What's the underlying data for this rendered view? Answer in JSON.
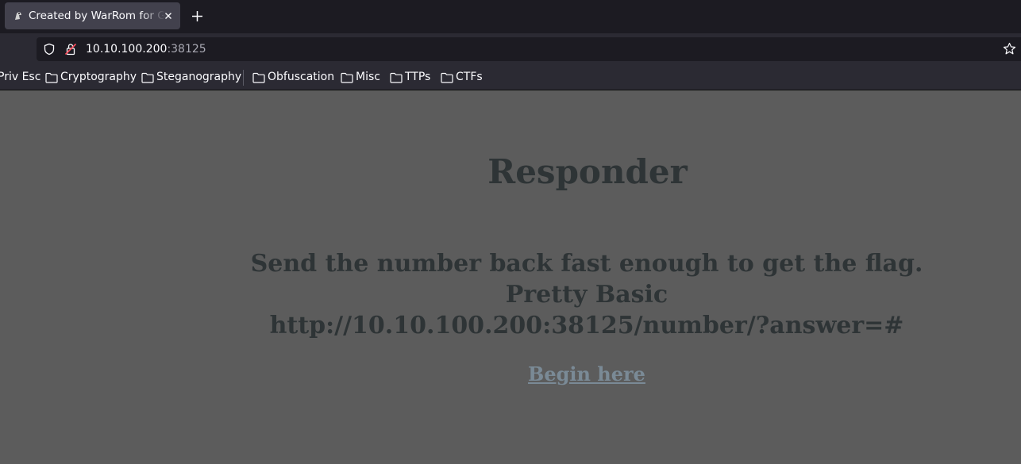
{
  "browser": {
    "tab_title": "Created by WarRom for GitHub",
    "url_host": "10.10.100.200",
    "url_port": ":38125",
    "bookmarks": [
      {
        "label": "Priv Esc",
        "icon": ""
      },
      {
        "label": "Cryptography",
        "icon": "folder-icon"
      },
      {
        "label": "Steganography",
        "icon": "folder-icon"
      },
      {
        "label": "Obfuscation",
        "icon": "folder-icon"
      },
      {
        "label": "Misc",
        "icon": "folder-icon"
      },
      {
        "label": "TTPs",
        "icon": "folder-icon"
      },
      {
        "label": "CTFs",
        "icon": "folder-icon"
      }
    ]
  },
  "page": {
    "title": "Responder",
    "line1": "Send the number back fast enough to get the flag.",
    "line2": "Pretty Basic",
    "line3": "http://10.10.100.200:38125/number/?answer=#",
    "link_text": "Begin here"
  },
  "colors": {
    "page_background": "#5c5c5c",
    "heading_text": "#2e3436",
    "link": "#7a8a96",
    "toolbar": "#2b2a33",
    "tabbar": "#1c1b22"
  }
}
